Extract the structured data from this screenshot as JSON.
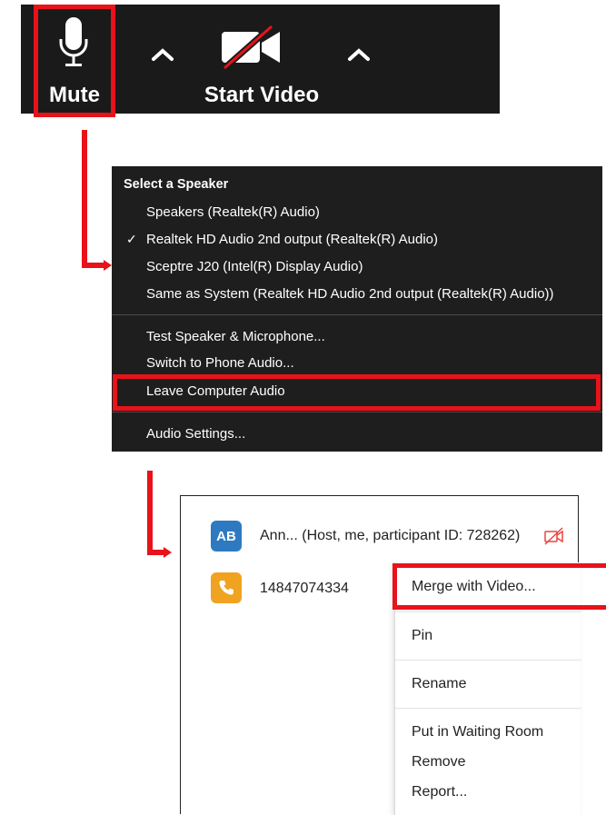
{
  "toolbar": {
    "mute_label": "Mute",
    "video_label": "Start Video",
    "mic_icon": "microphone-icon",
    "video_icon": "video-off-icon",
    "caret_icon": "caret-up-icon"
  },
  "speaker_menu": {
    "heading": "Select a Speaker",
    "speakers": [
      "Speakers (Realtek(R) Audio)",
      "Realtek HD Audio 2nd output (Realtek(R) Audio)",
      "Sceptre J20 (Intel(R) Display Audio)",
      "Same as System (Realtek HD Audio 2nd output (Realtek(R) Audio))"
    ],
    "selected_index": 1,
    "check_mark": "✓",
    "actions": [
      "Test Speaker & Microphone...",
      "Switch to Phone Audio...",
      "Leave Computer Audio"
    ],
    "settings": "Audio Settings..."
  },
  "participants": {
    "host_initials": "AB",
    "host_name": "Ann... (Host, me, participant ID: 728262)",
    "phone_number": "14847074334"
  },
  "context_menu": {
    "items": [
      "Merge with Video...",
      "Pin",
      "Rename",
      "Put in Waiting Room",
      "Remove",
      "Report..."
    ]
  },
  "colors": {
    "highlight": "#e8121a",
    "toolbar_bg": "#1a1a1a",
    "menu_bg": "#1e1e1e",
    "host_avatar": "#2d7ac1",
    "phone_avatar": "#f0a320"
  }
}
